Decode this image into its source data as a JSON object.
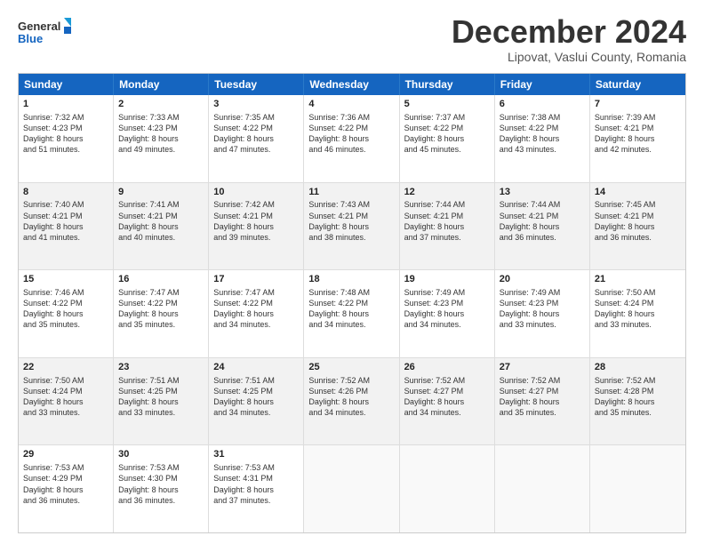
{
  "header": {
    "logo_line1": "General",
    "logo_line2": "Blue",
    "main_title": "December 2024",
    "subtitle": "Lipovat, Vaslui County, Romania"
  },
  "calendar": {
    "days": [
      "Sunday",
      "Monday",
      "Tuesday",
      "Wednesday",
      "Thursday",
      "Friday",
      "Saturday"
    ],
    "weeks": [
      [
        {
          "day": "1",
          "info": "Sunrise: 7:32 AM\nSunset: 4:23 PM\nDaylight: 8 hours\nand 51 minutes."
        },
        {
          "day": "2",
          "info": "Sunrise: 7:33 AM\nSunset: 4:23 PM\nDaylight: 8 hours\nand 49 minutes."
        },
        {
          "day": "3",
          "info": "Sunrise: 7:35 AM\nSunset: 4:22 PM\nDaylight: 8 hours\nand 47 minutes."
        },
        {
          "day": "4",
          "info": "Sunrise: 7:36 AM\nSunset: 4:22 PM\nDaylight: 8 hours\nand 46 minutes."
        },
        {
          "day": "5",
          "info": "Sunrise: 7:37 AM\nSunset: 4:22 PM\nDaylight: 8 hours\nand 45 minutes."
        },
        {
          "day": "6",
          "info": "Sunrise: 7:38 AM\nSunset: 4:22 PM\nDaylight: 8 hours\nand 43 minutes."
        },
        {
          "day": "7",
          "info": "Sunrise: 7:39 AM\nSunset: 4:21 PM\nDaylight: 8 hours\nand 42 minutes."
        }
      ],
      [
        {
          "day": "8",
          "info": "Sunrise: 7:40 AM\nSunset: 4:21 PM\nDaylight: 8 hours\nand 41 minutes."
        },
        {
          "day": "9",
          "info": "Sunrise: 7:41 AM\nSunset: 4:21 PM\nDaylight: 8 hours\nand 40 minutes."
        },
        {
          "day": "10",
          "info": "Sunrise: 7:42 AM\nSunset: 4:21 PM\nDaylight: 8 hours\nand 39 minutes."
        },
        {
          "day": "11",
          "info": "Sunrise: 7:43 AM\nSunset: 4:21 PM\nDaylight: 8 hours\nand 38 minutes."
        },
        {
          "day": "12",
          "info": "Sunrise: 7:44 AM\nSunset: 4:21 PM\nDaylight: 8 hours\nand 37 minutes."
        },
        {
          "day": "13",
          "info": "Sunrise: 7:44 AM\nSunset: 4:21 PM\nDaylight: 8 hours\nand 36 minutes."
        },
        {
          "day": "14",
          "info": "Sunrise: 7:45 AM\nSunset: 4:21 PM\nDaylight: 8 hours\nand 36 minutes."
        }
      ],
      [
        {
          "day": "15",
          "info": "Sunrise: 7:46 AM\nSunset: 4:22 PM\nDaylight: 8 hours\nand 35 minutes."
        },
        {
          "day": "16",
          "info": "Sunrise: 7:47 AM\nSunset: 4:22 PM\nDaylight: 8 hours\nand 35 minutes."
        },
        {
          "day": "17",
          "info": "Sunrise: 7:47 AM\nSunset: 4:22 PM\nDaylight: 8 hours\nand 34 minutes."
        },
        {
          "day": "18",
          "info": "Sunrise: 7:48 AM\nSunset: 4:22 PM\nDaylight: 8 hours\nand 34 minutes."
        },
        {
          "day": "19",
          "info": "Sunrise: 7:49 AM\nSunset: 4:23 PM\nDaylight: 8 hours\nand 34 minutes."
        },
        {
          "day": "20",
          "info": "Sunrise: 7:49 AM\nSunset: 4:23 PM\nDaylight: 8 hours\nand 33 minutes."
        },
        {
          "day": "21",
          "info": "Sunrise: 7:50 AM\nSunset: 4:24 PM\nDaylight: 8 hours\nand 33 minutes."
        }
      ],
      [
        {
          "day": "22",
          "info": "Sunrise: 7:50 AM\nSunset: 4:24 PM\nDaylight: 8 hours\nand 33 minutes."
        },
        {
          "day": "23",
          "info": "Sunrise: 7:51 AM\nSunset: 4:25 PM\nDaylight: 8 hours\nand 33 minutes."
        },
        {
          "day": "24",
          "info": "Sunrise: 7:51 AM\nSunset: 4:25 PM\nDaylight: 8 hours\nand 34 minutes."
        },
        {
          "day": "25",
          "info": "Sunrise: 7:52 AM\nSunset: 4:26 PM\nDaylight: 8 hours\nand 34 minutes."
        },
        {
          "day": "26",
          "info": "Sunrise: 7:52 AM\nSunset: 4:27 PM\nDaylight: 8 hours\nand 34 minutes."
        },
        {
          "day": "27",
          "info": "Sunrise: 7:52 AM\nSunset: 4:27 PM\nDaylight: 8 hours\nand 35 minutes."
        },
        {
          "day": "28",
          "info": "Sunrise: 7:52 AM\nSunset: 4:28 PM\nDaylight: 8 hours\nand 35 minutes."
        }
      ],
      [
        {
          "day": "29",
          "info": "Sunrise: 7:53 AM\nSunset: 4:29 PM\nDaylight: 8 hours\nand 36 minutes."
        },
        {
          "day": "30",
          "info": "Sunrise: 7:53 AM\nSunset: 4:30 PM\nDaylight: 8 hours\nand 36 minutes."
        },
        {
          "day": "31",
          "info": "Sunrise: 7:53 AM\nSunset: 4:31 PM\nDaylight: 8 hours\nand 37 minutes."
        },
        {
          "day": "",
          "info": ""
        },
        {
          "day": "",
          "info": ""
        },
        {
          "day": "",
          "info": ""
        },
        {
          "day": "",
          "info": ""
        }
      ]
    ]
  }
}
